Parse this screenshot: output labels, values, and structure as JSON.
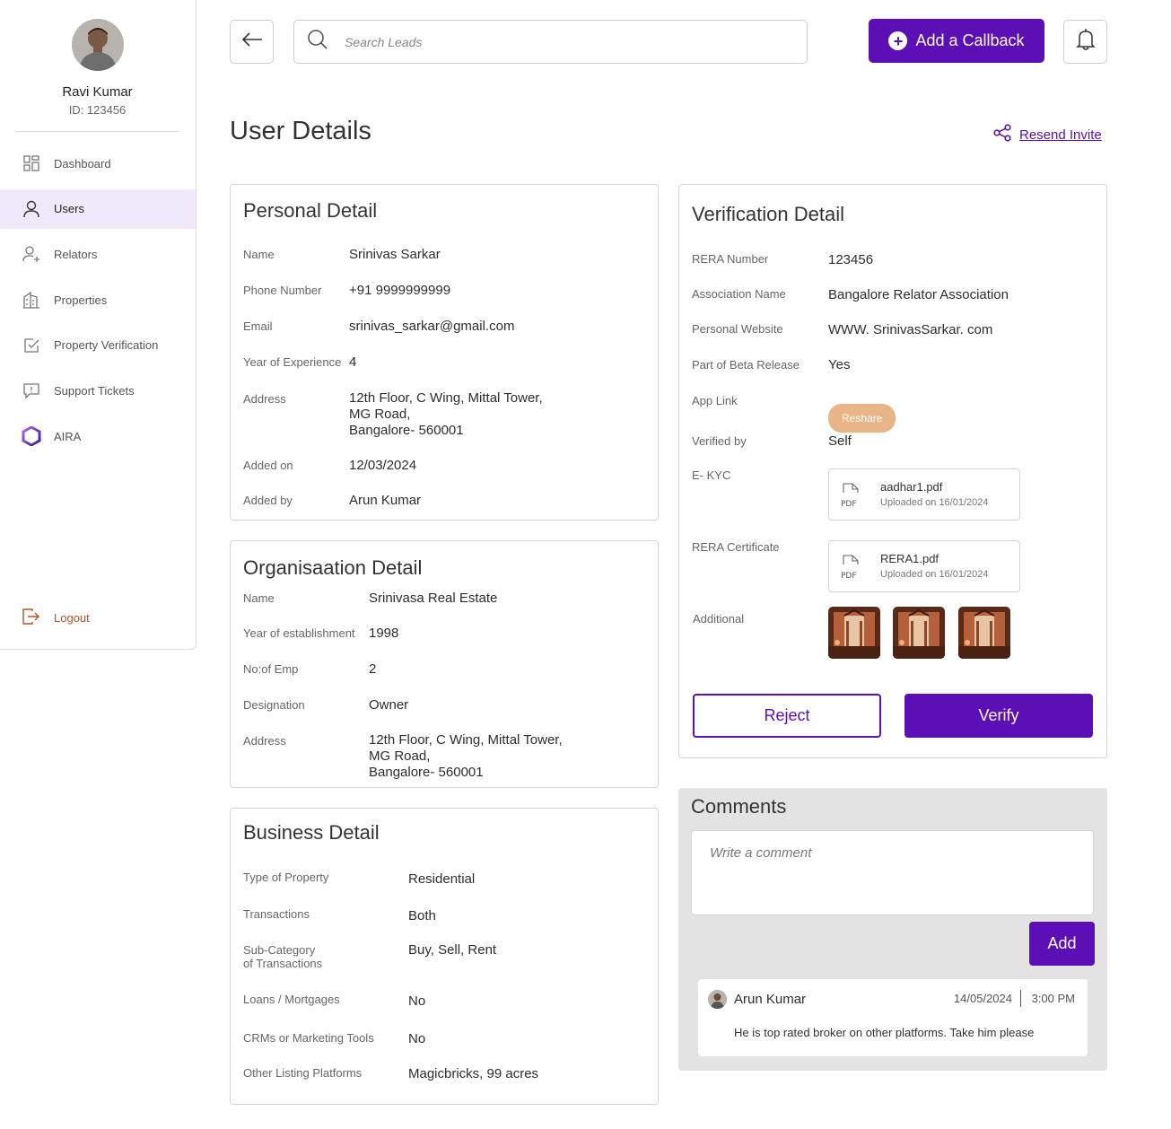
{
  "profile": {
    "name": "Ravi Kumar",
    "id_text": "ID: 123456"
  },
  "sidebar": {
    "items": [
      {
        "label": "Dashboard",
        "icon": "dashboard-icon"
      },
      {
        "label": "Users",
        "icon": "user-icon",
        "active": true
      },
      {
        "label": "Relators",
        "icon": "user-add-icon"
      },
      {
        "label": "Properties",
        "icon": "building-icon"
      },
      {
        "label": "Property Verification",
        "icon": "check-square-icon"
      },
      {
        "label": "Support Tickets",
        "icon": "message-alert-icon"
      },
      {
        "label": "AIRA",
        "icon": "hexagon-logo-icon"
      }
    ],
    "logout_label": "Logout"
  },
  "topbar": {
    "search_placeholder": "Search Leads",
    "callback_label": "Add a Callback"
  },
  "page": {
    "title": "User Details",
    "resend_label": "Resend Invite"
  },
  "personal": {
    "title": "Personal Detail",
    "rows": [
      {
        "label": "Name",
        "value": "Srinivas Sarkar"
      },
      {
        "label": "Phone Number",
        "value": "+91 9999999999"
      },
      {
        "label": "Email",
        "value": "srinivas_sarkar@gmail.com"
      },
      {
        "label": "Year of Experience",
        "value": "4"
      },
      {
        "label": "Address",
        "value": "12th Floor, C Wing, Mittal Tower,\nMG Road,\nBangalore- 560001"
      },
      {
        "label": "Added on",
        "value": "12/03/2024"
      },
      {
        "label": "Added by",
        "value": "Arun Kumar"
      }
    ]
  },
  "organisation": {
    "title": "Organisaation Detail",
    "rows": [
      {
        "label": "Name",
        "value": "Srinivasa Real Estate"
      },
      {
        "label": "Year of establishment",
        "value": "1998"
      },
      {
        "label": "No:of Emp",
        "value": "2"
      },
      {
        "label": "Designation",
        "value": "Owner"
      },
      {
        "label": "Address",
        "value": "12th Floor, C Wing, Mittal Tower,\nMG Road,\nBangalore- 560001"
      }
    ]
  },
  "business": {
    "title": "Business Detail",
    "rows": [
      {
        "label": "Type of Property",
        "value": "Residential"
      },
      {
        "label": "Transactions",
        "value": "Both"
      },
      {
        "label": "Sub-Category\nof Transactions",
        "value": "Buy, Sell, Rent"
      },
      {
        "label": "Loans / Mortgages",
        "value": "No"
      },
      {
        "label": "CRMs or Marketing Tools",
        "value": "No"
      },
      {
        "label": "Other Listing Platforms",
        "value": "Magicbricks, 99 acres"
      }
    ]
  },
  "verification": {
    "title": "Verification Detail",
    "rows": [
      {
        "label": "RERA Number",
        "value": "123456"
      },
      {
        "label": "Association Name",
        "value": "Bangalore Relator Association"
      },
      {
        "label": "Personal Website",
        "value": "WWW. SrinivasSarkar. com"
      },
      {
        "label": "Part of Beta Release",
        "value": "Yes"
      },
      {
        "label": "App Link",
        "value": ""
      },
      {
        "label": "Verified by",
        "value": "Self"
      },
      {
        "label": "E- KYC",
        "value": ""
      },
      {
        "label": "RERA Certificate",
        "value": ""
      },
      {
        "label": "Additional",
        "value": ""
      }
    ],
    "reshare_label": "Reshare",
    "ekyc_file": {
      "name": "aadhar1.pdf",
      "uploaded": "Uploaded on 16/01/2024"
    },
    "rera_file": {
      "name": "RERA1.pdf",
      "uploaded": "Uploaded on 16/01/2024"
    },
    "pdf_tag": "PDF",
    "reject_label": "Reject",
    "verify_label": "Verify"
  },
  "comments": {
    "title": "Comments",
    "placeholder": "Write a comment",
    "add_label": "Add",
    "items": [
      {
        "author": "Arun Kumar",
        "date": "14/05/2024",
        "time": "3:00 PM",
        "text": "He is top rated broker on other platforms. Take him please"
      }
    ]
  },
  "colors": {
    "accent": "#5c0fb5",
    "reshare": "#e9b486",
    "logout": "#b0572a",
    "active_nav": "#efe9fb"
  }
}
